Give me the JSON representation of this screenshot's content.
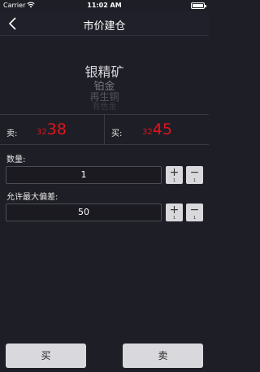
{
  "status_bar": {
    "carrier": "Carrier",
    "time": "11:02 AM"
  },
  "nav": {
    "title": "市价建仓",
    "back_icon": "chevron-left-icon"
  },
  "product_picker": {
    "items": [
      "银精矿",
      "铂金",
      "再生铜",
      "有色金"
    ]
  },
  "prices": {
    "sell_label": "卖:",
    "sell_prefix": "32",
    "sell_main": "38",
    "buy_label": "买:",
    "buy_prefix": "32",
    "buy_main": "45",
    "price_color": "#e0141e"
  },
  "quantity": {
    "label": "数量:",
    "value": "1",
    "plus": "+",
    "minus": "−",
    "step": "1"
  },
  "deviation": {
    "label": "允许最大偏差:",
    "value": "50",
    "plus": "+",
    "minus": "−",
    "step": "1"
  },
  "actions": {
    "buy_label": "买",
    "sell_label": "卖"
  }
}
